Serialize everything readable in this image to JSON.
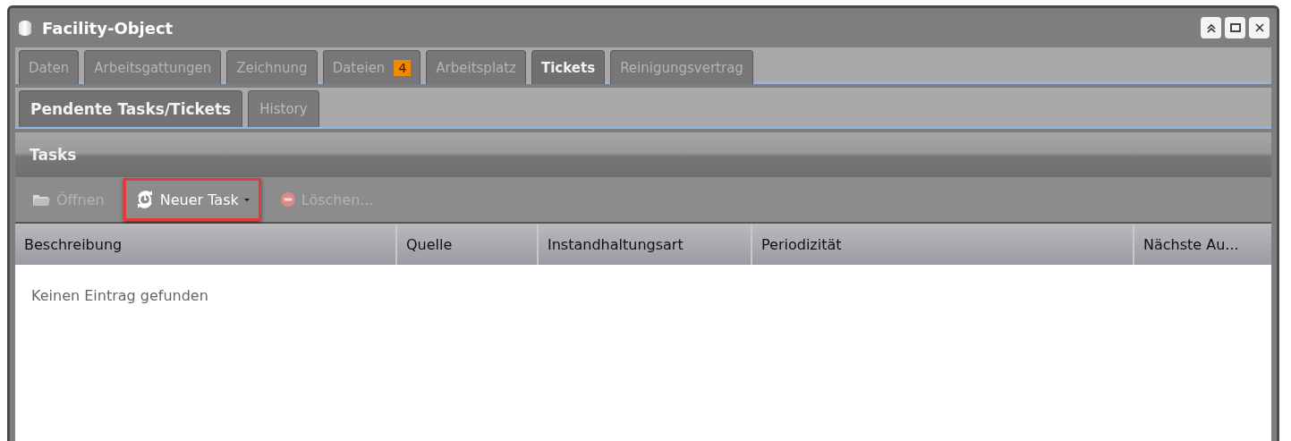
{
  "window": {
    "title": "Facility-Object",
    "controls": [
      {
        "kind": "collapse"
      },
      {
        "kind": "maximize"
      },
      {
        "kind": "close"
      }
    ]
  },
  "tabs": [
    {
      "label": "Daten",
      "selected": false
    },
    {
      "label": "Arbeitsgattungen",
      "selected": false
    },
    {
      "label": "Zeichnung",
      "selected": false
    },
    {
      "label": "Dateien",
      "selected": false,
      "badge": "4"
    },
    {
      "label": "Arbeitsplatz",
      "selected": false
    },
    {
      "label": "Tickets",
      "selected": true
    },
    {
      "label": "Reinigungsvertrag",
      "selected": false
    }
  ],
  "subtabs": [
    {
      "label": "Pendente Tasks/Tickets",
      "selected": true
    },
    {
      "label": "History",
      "selected": false
    }
  ],
  "panel": {
    "title": "Tasks"
  },
  "toolbar": [
    {
      "label": "Öffnen",
      "kind": "open",
      "disabled": true,
      "dropdown": false,
      "highlighted": false
    },
    {
      "label": "Neuer Task",
      "kind": "create",
      "disabled": false,
      "dropdown": true,
      "highlighted": true
    },
    {
      "label": "Löschen...",
      "kind": "remove",
      "disabled": true,
      "dropdown": false,
      "highlighted": false
    }
  ],
  "table": {
    "columns": [
      "Beschreibung",
      "Quelle",
      "Instandhaltungsart",
      "Periodizität",
      "Nächste Au..."
    ],
    "empty_text": "Keinen Eintrag gefunden"
  }
}
